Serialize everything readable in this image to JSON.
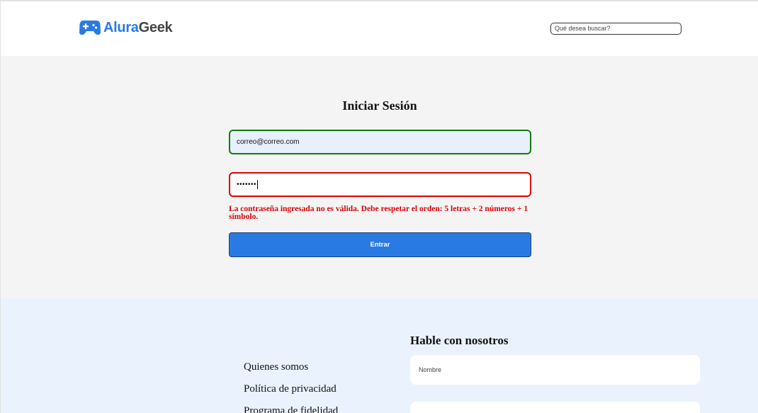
{
  "header": {
    "logo": {
      "part1": "Alura",
      "part2": "Geek"
    },
    "search": {
      "placeholder": "Qué desea buscar?"
    }
  },
  "login": {
    "title": "Iniciar Sesión",
    "email": {
      "value": "correo@correo.com"
    },
    "password": {
      "masked": "•••••••"
    },
    "error": "La contraseña ingresada no es válida. Debe respetar el orden: 5 letras + 2 números + 1 símbolo.",
    "submit_label": "Entrar"
  },
  "footer": {
    "links": [
      "Quienes somos",
      "Política de privacidad",
      "Programa de fidelidad"
    ],
    "contact": {
      "title": "Hable con nosotros",
      "name_placeholder": "Nombre"
    }
  },
  "colors": {
    "accent": "#2a7ae4",
    "valid": "#0a7e0a",
    "error": "#e00000",
    "login_bg": "#f4f4f4",
    "footer_bg": "#eaf2fd"
  }
}
